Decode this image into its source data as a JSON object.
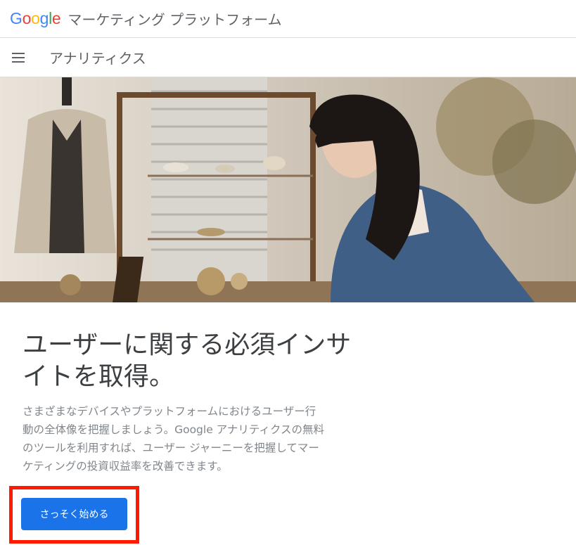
{
  "header": {
    "logo_letters": [
      {
        "char": "G",
        "color": "#4285F4"
      },
      {
        "char": "o",
        "color": "#EA4335"
      },
      {
        "char": "o",
        "color": "#FBBC05"
      },
      {
        "char": "g",
        "color": "#4285F4"
      },
      {
        "char": "l",
        "color": "#34A853"
      },
      {
        "char": "e",
        "color": "#EA4335"
      }
    ],
    "brand_name": "マーケティング プラットフォーム"
  },
  "nav": {
    "menu_icon": "hamburger-menu-icon",
    "product_name": "アナリティクス"
  },
  "hero": {
    "image": "photo of a woman using a laptop in a shop"
  },
  "main": {
    "headline_line1": "ユーザーに関する必須インサ",
    "headline_line2": "イトを取得。",
    "description_line1": "さまざまなデバイスやプラットフォームにおけるユーザー行",
    "description_line2": "動の全体像を把握しましょう。Google アナリティクスの無料",
    "description_line3": "のツールを利用すれば、ユーザー ジャーニーを把握してマー",
    "description_line4": "ケティングの投資収益率を改善できます。",
    "cta_label": "さっそく始める"
  },
  "colors": {
    "accent": "#1a73e8",
    "highlight_border": "#ff1a00"
  }
}
